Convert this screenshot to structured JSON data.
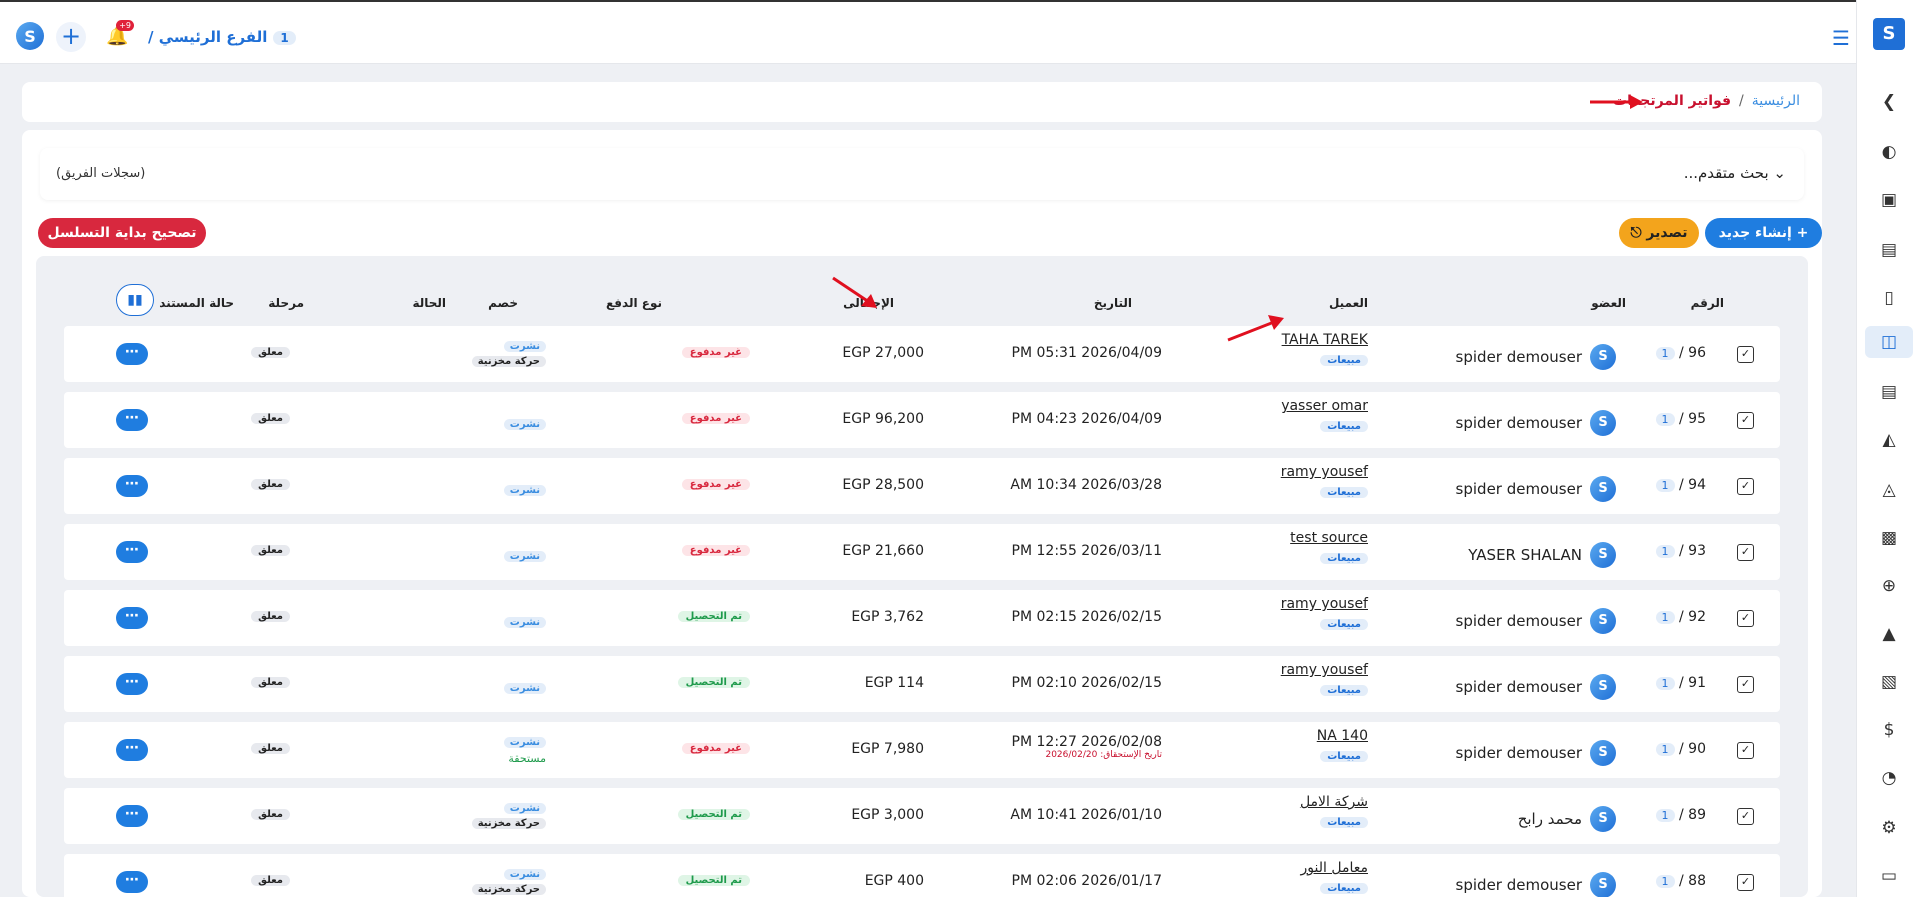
{
  "topbar": {
    "branch_label": "الفرع الرئيسي /",
    "branch_num": "1",
    "notif_count": "+9",
    "logo_letter": "S"
  },
  "sidebar": {
    "brand_letter": "S",
    "icons": [
      "chevron-left-icon",
      "gauge-icon",
      "pos-icon",
      "register-icon",
      "invoice-icon",
      "return-invoice-icon",
      "document-icon",
      "invoice-off-icon",
      "invoice-tag-icon",
      "device-icon",
      "add-invoice-icon",
      "add-doc-icon",
      "cash-icon",
      "dollar-doc-icon",
      "chart-icon",
      "gear-icon",
      "window-icon"
    ]
  },
  "breadcrumb": {
    "home": "الرئيسية",
    "separator": "/",
    "current": "فواتير المرتجعات"
  },
  "search": {
    "advanced_label": "بحث متقدم...",
    "team_label": "(سجلات الفريق)"
  },
  "actions": {
    "new_label": "+ إنشاء جديد",
    "export_label": "تصدير",
    "fix_label": "تصحيح بداية التسلسل"
  },
  "table": {
    "headers": {
      "number": "الرقم",
      "member": "العضو",
      "client": "العميل",
      "date": "التاريخ",
      "total": "الإجمالى",
      "payment_type": "نوع الدفع",
      "discount": "خصم",
      "status": "الحالة",
      "stage": "مرحلة",
      "doc_state": "حالة المستند"
    },
    "rows": [
      {
        "num": "96",
        "branch": "1",
        "member": "spider demouser",
        "client": "TAHA TAREK",
        "client_tag": "مبيعات",
        "date": "PM 05:31 2026/04/09",
        "due": "",
        "total": "EGP 27,000",
        "pay": "غير مدفوع",
        "paid": false,
        "status": "نشرت",
        "status2": "حركة مخزنية",
        "status_due": "",
        "doc": "معلق"
      },
      {
        "num": "95",
        "branch": "1",
        "member": "spider demouser",
        "client": "yasser omar",
        "client_tag": "مبيعات",
        "date": "PM 04:23 2026/04/09",
        "due": "",
        "total": "EGP 96,200",
        "pay": "غير مدفوع",
        "paid": false,
        "status": "نشرت",
        "status2": "",
        "status_due": "",
        "doc": "معلق"
      },
      {
        "num": "94",
        "branch": "1",
        "member": "spider demouser",
        "client": "ramy yousef",
        "client_tag": "مبيعات",
        "date": "AM 10:34 2026/03/28",
        "due": "",
        "total": "EGP 28,500",
        "pay": "غير مدفوع",
        "paid": false,
        "status": "نشرت",
        "status2": "",
        "status_due": "",
        "doc": "معلق"
      },
      {
        "num": "93",
        "branch": "1",
        "member": "YASER SHALAN",
        "client": "test source",
        "client_tag": "مبيعات",
        "date": "PM 12:55 2026/03/11",
        "due": "",
        "total": "EGP 21,660",
        "pay": "غير مدفوع",
        "paid": false,
        "status": "نشرت",
        "status2": "",
        "status_due": "",
        "doc": "معلق"
      },
      {
        "num": "92",
        "branch": "1",
        "member": "spider demouser",
        "client": "ramy yousef",
        "client_tag": "مبيعات",
        "date": "PM 02:15 2026/02/15",
        "due": "",
        "total": "EGP 3,762",
        "pay": "تم التحصيل",
        "paid": true,
        "status": "نشرت",
        "status2": "",
        "status_due": "",
        "doc": "معلق"
      },
      {
        "num": "91",
        "branch": "1",
        "member": "spider demouser",
        "client": "ramy yousef",
        "client_tag": "مبيعات",
        "date": "PM 02:10 2026/02/15",
        "due": "",
        "total": "EGP 114",
        "pay": "تم التحصيل",
        "paid": true,
        "status": "نشرت",
        "status2": "",
        "status_due": "",
        "doc": "معلق"
      },
      {
        "num": "90",
        "branch": "1",
        "member": "spider demouser",
        "client": "NA 140",
        "client_tag": "مبيعات",
        "date": "PM 12:27 2026/02/08",
        "due": "تاريخ الإستحقاق: 2026/02/20",
        "total": "EGP 7,980",
        "pay": "غير مدفوع",
        "paid": false,
        "status": "نشرت",
        "status2": "",
        "status_due": "مستحقة",
        "doc": "معلق"
      },
      {
        "num": "89",
        "branch": "1",
        "member": "محمد رابح",
        "client": "شركة الامل",
        "client_tag": "مبيعات",
        "date": "AM 10:41 2026/01/10",
        "due": "",
        "total": "EGP 3,000",
        "pay": "تم التحصيل",
        "paid": true,
        "status": "نشرت",
        "status2": "حركة مخزنية",
        "status_due": "",
        "doc": "معلق"
      },
      {
        "num": "88",
        "branch": "1",
        "member": "spider demouser",
        "client": "معامل النور",
        "client_tag": "مبيعات",
        "date": "PM 02:06 2026/01/17",
        "due": "",
        "total": "EGP 400",
        "pay": "تم التحصيل",
        "paid": true,
        "status": "نشرت",
        "status2": "حركة مخزنية",
        "status_due": "",
        "doc": "معلق"
      }
    ]
  },
  "colors": {
    "primary": "#1f7de0",
    "danger": "#d8283e",
    "warning": "#f3a41c",
    "annotation": "#e0101f"
  }
}
